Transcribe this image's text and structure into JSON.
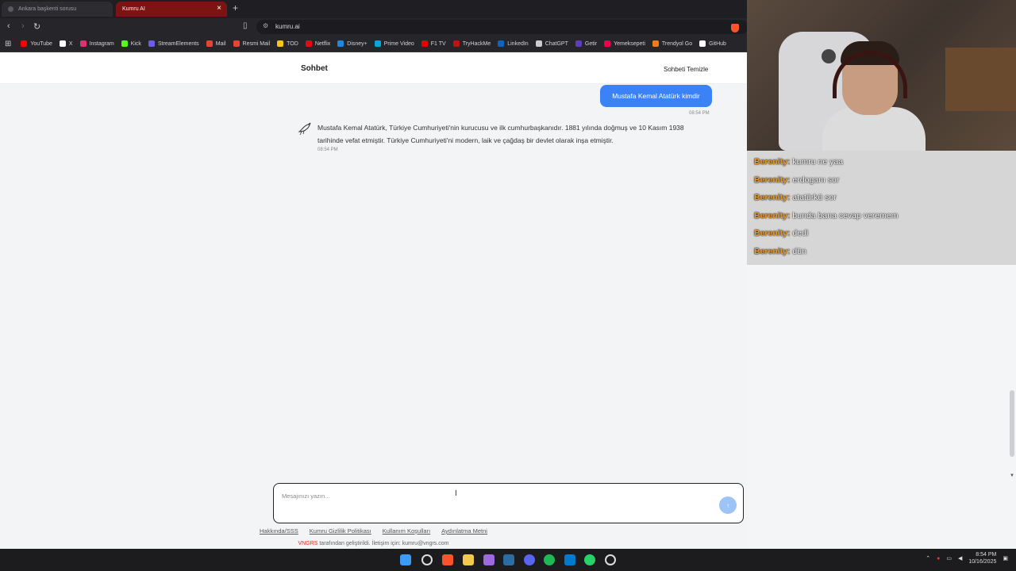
{
  "browser": {
    "tabs": [
      {
        "title": "Ankara başkenti sorusu"
      },
      {
        "title": "Kumru AI"
      }
    ],
    "url": "kumru.ai",
    "bookmarks": [
      {
        "label": "YouTube",
        "color": "#ff0000"
      },
      {
        "label": "X",
        "color": "#ffffff"
      },
      {
        "label": "Instagram",
        "color": "#e1306c"
      },
      {
        "label": "Kick",
        "color": "#53fc18"
      },
      {
        "label": "StreamElements",
        "color": "#6c5ce7"
      },
      {
        "label": "Mail",
        "color": "#ea4335"
      },
      {
        "label": "Resmi Mail",
        "color": "#ea4335"
      },
      {
        "label": "TOD",
        "color": "#f5c518"
      },
      {
        "label": "Netflix",
        "color": "#e50914"
      },
      {
        "label": "Disney+",
        "color": "#1e88e5"
      },
      {
        "label": "Prime Video",
        "color": "#00a8e1"
      },
      {
        "label": "F1 TV",
        "color": "#e10600"
      },
      {
        "label": "TryHackMe",
        "color": "#c11111"
      },
      {
        "label": "LinkedIn",
        "color": "#0a66c2"
      },
      {
        "label": "ChatGPT",
        "color": "#cccccc"
      },
      {
        "label": "Getir",
        "color": "#5d3ebc"
      },
      {
        "label": "Yemeksepeti",
        "color": "#ea004b"
      },
      {
        "label": "Trendyol Go",
        "color": "#f27a1a"
      },
      {
        "label": "GitHub",
        "color": "#ffffff"
      }
    ]
  },
  "page": {
    "title": "Sohbet",
    "clear_label": "Sohbeti Temizle",
    "user_message": "Mustafa Kemal Atatürk kimdir",
    "user_time": "08:54 PM",
    "bot_message": "Mustafa Kemal Atatürk, Türkiye Cumhuriyeti'nin kurucusu ve ilk cumhurbaşkanıdır. 1881 yılında doğmuş ve 10 Kasım 1938 tarihinde vefat etmiştir. Türkiye Cumhuriyeti'ni modern, laik ve çağdaş bir devlet olarak inşa etmiştir.",
    "bot_time": "08:54 PM",
    "input_placeholder": "Mesajınızı yazın...",
    "footer_links": [
      "Hakkında/SSS",
      "Kumru Gizlilik Politikası",
      "Kullanım Koşulları",
      "Aydınlatma Metni"
    ],
    "footer_brand": "VNGRS",
    "footer_note": " tarafından geliştirildi. İletişim için: kumru@vngrs.com"
  },
  "stream_chat": [
    {
      "user": "Berenity:",
      "text": " kumru ne yaa"
    },
    {
      "user": "Berenity:",
      "text": " erdoganı sor"
    },
    {
      "user": "Berenity:",
      "text": " atatürkü sor"
    },
    {
      "user": "Berenity:",
      "text": " bunda bana cevap veremem"
    },
    {
      "user": "Berenity:",
      "text": " dedi"
    },
    {
      "user": "Berenity:",
      "text": " dün"
    }
  ],
  "taskbar": {
    "time": "8:54 PM",
    "date": "10/16/2025"
  }
}
